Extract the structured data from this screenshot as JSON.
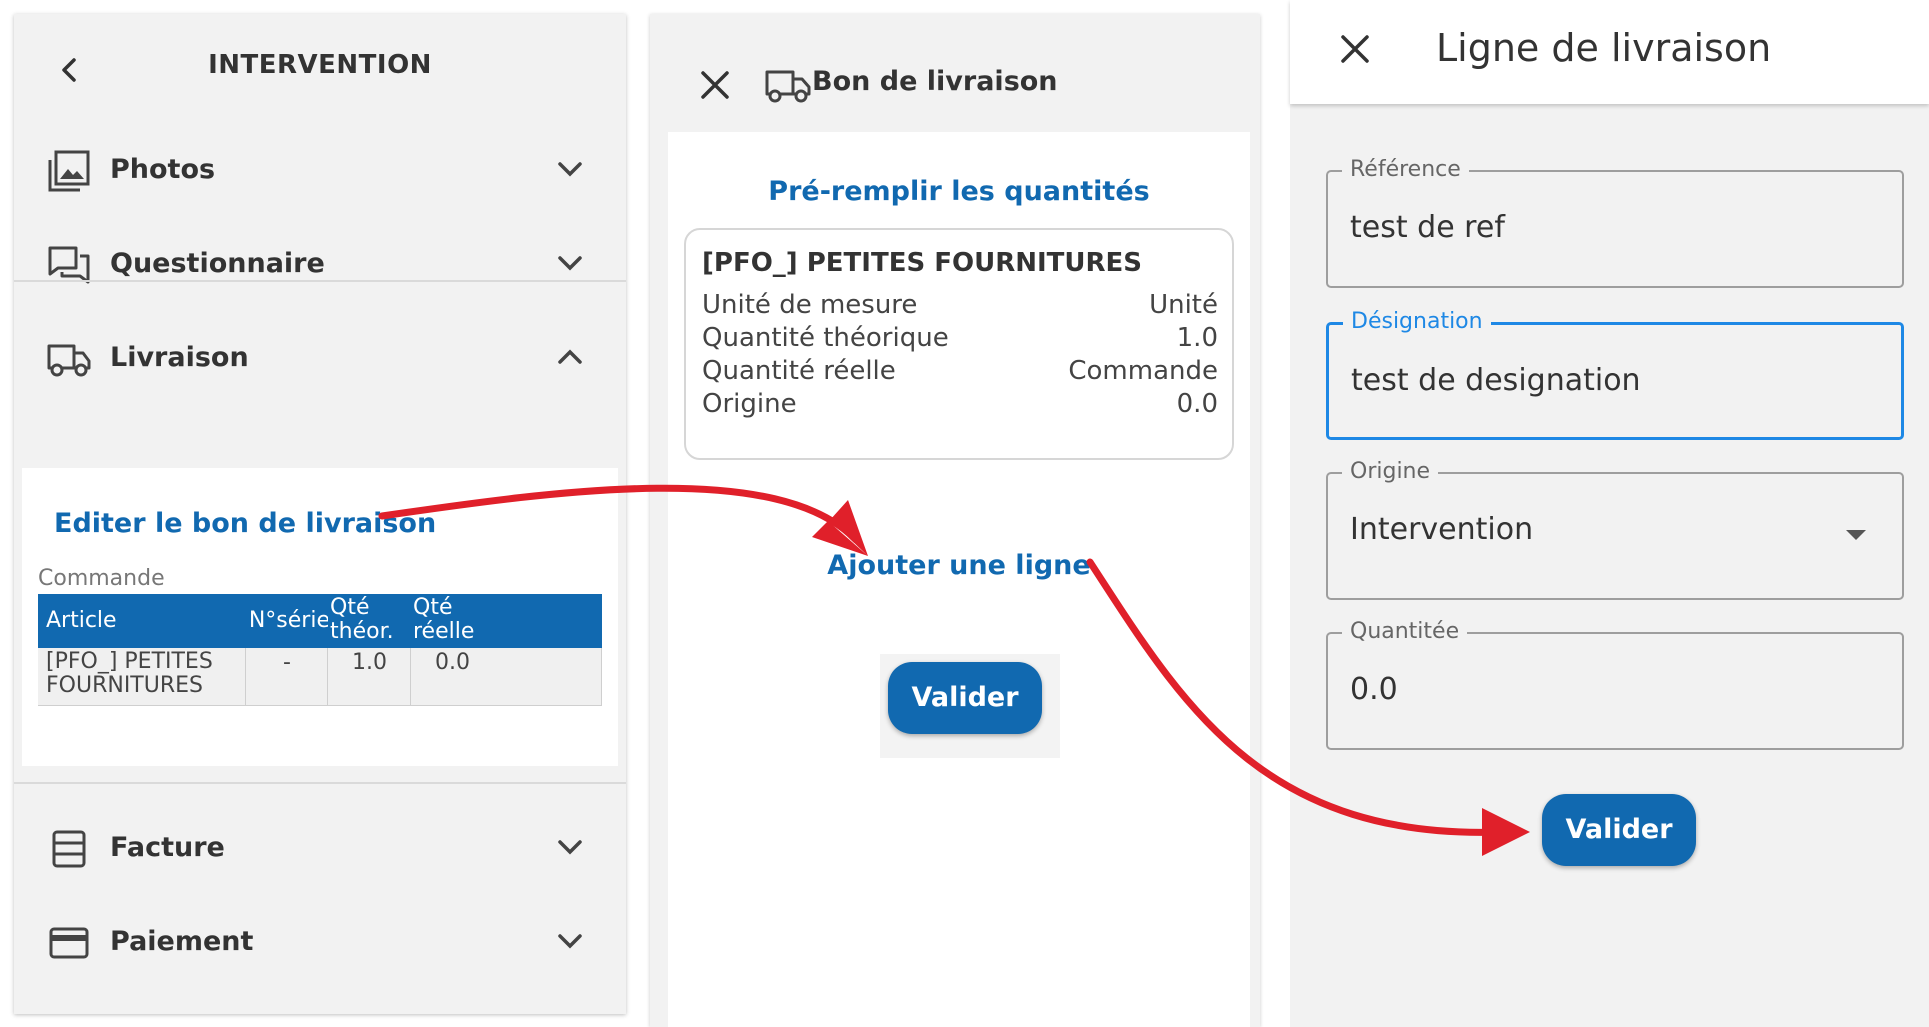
{
  "intervention": {
    "title": "INTERVENTION",
    "sections": {
      "photos": "Photos",
      "questionnaire": "Questionnaire",
      "livraison": "Livraison",
      "facture": "Facture",
      "paiement": "Paiement"
    },
    "edit_link": "Editer le bon de livraison",
    "table_caption": "Commande",
    "table": {
      "headers": [
        "Article",
        "N°série",
        "Qté théor.",
        "Qté réelle"
      ],
      "rows": [
        [
          "[PFO_] PETITES FOURNITURES",
          "-",
          "1.0",
          "0.0"
        ]
      ]
    }
  },
  "delivery_note": {
    "title": "Bon de livraison",
    "prefill_link": "Pré-remplir les quantités",
    "item": {
      "name": "[PFO_] PETITES FOURNITURES",
      "fields": [
        {
          "label": "Unité de mesure",
          "value": "Unité"
        },
        {
          "label": "Quantité théorique",
          "value": "1.0"
        },
        {
          "label": "Quantité réelle",
          "value": "Commande"
        },
        {
          "label": "Origine",
          "value": "0.0"
        }
      ]
    },
    "add_line_link": "Ajouter une ligne",
    "validate_label": "Valider"
  },
  "delivery_line": {
    "title": "Ligne de livraison",
    "fields": {
      "reference": {
        "label": "Référence",
        "value": "test de ref"
      },
      "designation": {
        "label": "Désignation",
        "value": "test de designation"
      },
      "origine": {
        "label": "Origine",
        "value": "Intervention"
      },
      "quantite": {
        "label": "Quantitée",
        "value": "0.0"
      }
    },
    "validate_label": "Valider"
  },
  "colors": {
    "accent": "#1169b0",
    "focus": "#1e88e5",
    "annotation_arrow": "#e0202a"
  }
}
